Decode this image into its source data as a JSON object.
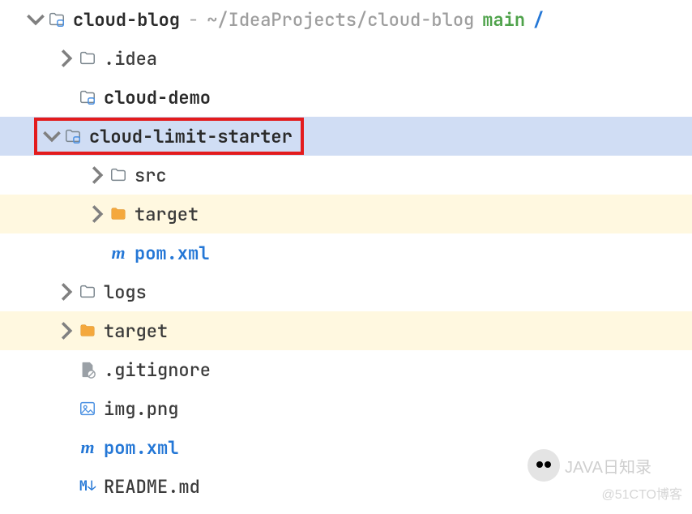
{
  "root": {
    "name": "cloud-blog",
    "path": "~/IdeaProjects/cloud-blog",
    "branch": "main",
    "dirty": "/"
  },
  "rows": [
    {
      "name": ".idea"
    },
    {
      "name": "cloud-demo"
    },
    {
      "name": "cloud-limit-starter"
    },
    {
      "name": "src"
    },
    {
      "name": "target"
    },
    {
      "name": "pom.xml"
    },
    {
      "name": "logs"
    },
    {
      "name": "target"
    },
    {
      "name": ".gitignore"
    },
    {
      "name": "img.png"
    },
    {
      "name": "pom.xml"
    },
    {
      "name": "README.md"
    }
  ],
  "watermark1": "JAVA日知录",
  "watermark2": "@51CTO博客"
}
